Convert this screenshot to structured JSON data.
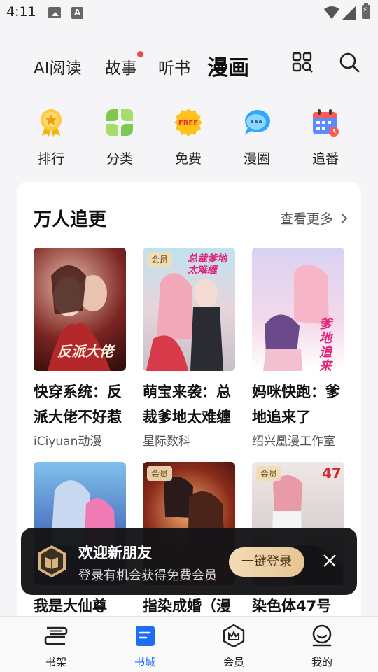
{
  "status": {
    "time": "4:11"
  },
  "top_tabs": [
    {
      "label": "AI阅读",
      "active": false
    },
    {
      "label": "故事",
      "active": false,
      "dot": true
    },
    {
      "label": "听书",
      "active": false
    },
    {
      "label": "漫画",
      "active": true
    }
  ],
  "categories": [
    {
      "label": "排行",
      "icon": "medal-icon"
    },
    {
      "label": "分类",
      "icon": "category-icon"
    },
    {
      "label": "免费",
      "icon": "free-badge-icon",
      "badge_text": "FREE"
    },
    {
      "label": "漫圈",
      "icon": "chat-bubble-icon"
    },
    {
      "label": "追番",
      "icon": "calendar-icon"
    }
  ],
  "section": {
    "title": "万人追更",
    "more": "查看更多"
  },
  "books": [
    {
      "title": "快穿系统：反派大佬不好惹",
      "author": "iCiyuan动漫",
      "vip": false,
      "cover_text": "反派大佬"
    },
    {
      "title": "萌宝来袭：总裁爹地太难缠",
      "author": "星际数科",
      "vip": true,
      "vip_label": "会员",
      "cover_text": "总裁爹地太难缠"
    },
    {
      "title": "妈咪快跑：爹地追来了",
      "author": "绍兴凰漫工作室",
      "vip": false,
      "cover_text": "爹地追来了"
    },
    {
      "title": "我是大仙尊",
      "author": "",
      "vip": false,
      "cover_text": ""
    },
    {
      "title": "指染成婚（漫",
      "author": "",
      "vip": true,
      "vip_label": "会员",
      "cover_text": ""
    },
    {
      "title": "染色体47号",
      "author": "",
      "vip": true,
      "vip_label": "会员",
      "cover_text": "47"
    }
  ],
  "login_banner": {
    "title": "欢迎新朋友",
    "subtitle": "登录有机会获得免费会员",
    "button": "一键登录"
  },
  "bottom_nav": [
    {
      "label": "书架",
      "active": false
    },
    {
      "label": "书城",
      "active": true
    },
    {
      "label": "会员",
      "active": false
    },
    {
      "label": "我的",
      "active": false
    }
  ],
  "colors": {
    "accent": "#1e6ef5",
    "gold": "#e7c594",
    "dot": "#f04848"
  }
}
